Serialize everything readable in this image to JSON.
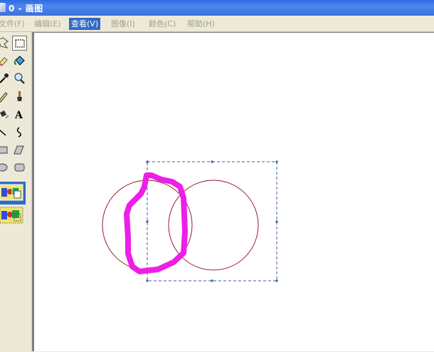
{
  "window": {
    "title": "0 - 画图"
  },
  "menu": {
    "items": [
      {
        "label": "文件(F)"
      },
      {
        "label": "编辑(E)"
      },
      {
        "label": "查看(V)"
      },
      {
        "label": "图像(I)"
      },
      {
        "label": "颜色(C)"
      },
      {
        "label": "帮助(H)"
      }
    ],
    "active": "查看(V)"
  },
  "toolbox": {
    "tools": [
      "free-form-select-icon",
      "rectangle-select-icon",
      "eraser-icon",
      "fill-bucket-icon",
      "pick-color-icon",
      "magnifier-icon",
      "pencil-icon",
      "brush-icon",
      "airbrush-icon",
      "text-tool-icon",
      "line-icon",
      "curve-icon",
      "rectangle-icon",
      "polygon-icon",
      "ellipse-icon",
      "rounded-rectangle-icon"
    ],
    "selected_tool": "rectangle-select-icon",
    "text_tool_glyph": "A",
    "selection_options": [
      "opaque-selection-icon",
      "transparent-selection-icon"
    ],
    "selected_option": "opaque-selection-icon"
  },
  "canvas": {
    "background": "#ffffff",
    "circle_color": "#9b1c2a",
    "stroke_color": "#ee1ee8",
    "selection_border_color": "#3a5f9e"
  }
}
